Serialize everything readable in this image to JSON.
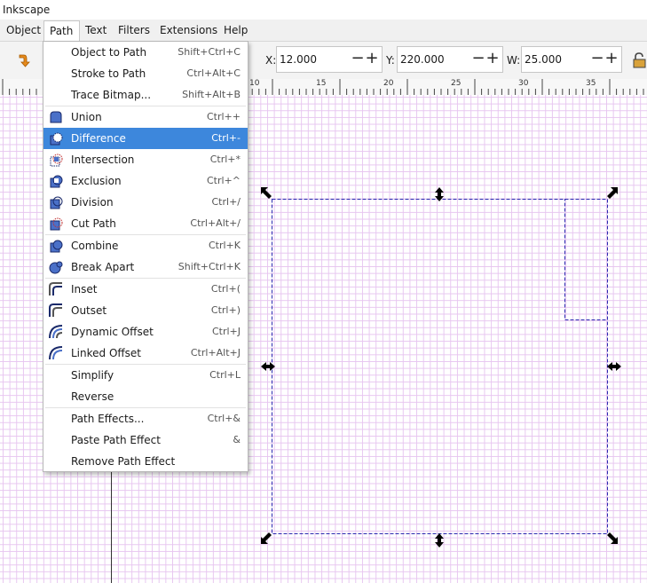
{
  "app": {
    "title": "Inkscape"
  },
  "menubar": [
    "Object",
    "Path",
    "Text",
    "Filters",
    "Extensions",
    "Help"
  ],
  "toolbar": {
    "x": {
      "label": "X:",
      "value": "12.000"
    },
    "y": {
      "label": "Y:",
      "value": "220.000"
    },
    "w": {
      "label": "W:",
      "value": "25.000"
    },
    "minus": "−",
    "plus": "+"
  },
  "ruler": {
    "ticks": [
      "10",
      "15",
      "20",
      "25",
      "30",
      "35"
    ]
  },
  "path_menu": {
    "highlighted": "Difference",
    "items": [
      {
        "label": "Object to Path",
        "shortcut": "Shift+Ctrl+C",
        "icon": "none"
      },
      {
        "label": "Stroke to Path",
        "shortcut": "Ctrl+Alt+C",
        "icon": "none"
      },
      {
        "label": "Trace Bitmap...",
        "shortcut": "Shift+Alt+B",
        "icon": "none"
      },
      {
        "label": "Union",
        "shortcut": "Ctrl++",
        "icon": "union-icon"
      },
      {
        "label": "Difference",
        "shortcut": "Ctrl+-",
        "icon": "difference-icon"
      },
      {
        "label": "Intersection",
        "shortcut": "Ctrl+*",
        "icon": "intersection-icon"
      },
      {
        "label": "Exclusion",
        "shortcut": "Ctrl+^",
        "icon": "exclusion-icon"
      },
      {
        "label": "Division",
        "shortcut": "Ctrl+/",
        "icon": "division-icon"
      },
      {
        "label": "Cut Path",
        "shortcut": "Ctrl+Alt+/",
        "icon": "cut-path-icon"
      },
      {
        "label": "Combine",
        "shortcut": "Ctrl+K",
        "icon": "combine-icon"
      },
      {
        "label": "Break Apart",
        "shortcut": "Shift+Ctrl+K",
        "icon": "break-apart-icon"
      },
      {
        "label": "Inset",
        "shortcut": "Ctrl+(",
        "icon": "inset-icon"
      },
      {
        "label": "Outset",
        "shortcut": "Ctrl+)",
        "icon": "outset-icon"
      },
      {
        "label": "Dynamic Offset",
        "shortcut": "Ctrl+J",
        "icon": "dynamic-offset-icon"
      },
      {
        "label": "Linked Offset",
        "shortcut": "Ctrl+Alt+J",
        "icon": "linked-offset-icon"
      },
      {
        "label": "Simplify",
        "shortcut": "Ctrl+L",
        "icon": "none"
      },
      {
        "label": "Reverse",
        "shortcut": "",
        "icon": "none"
      },
      {
        "label": "Path Effects...",
        "shortcut": "Ctrl+&",
        "icon": "none"
      },
      {
        "label": "Paste Path Effect",
        "shortcut": "&",
        "icon": "none"
      },
      {
        "label": "Remove Path Effect",
        "shortcut": "",
        "icon": "none"
      }
    ]
  },
  "colors": {
    "grid": "#e7c6f0",
    "highlight": "#3d87dc",
    "selection": "#2b2bb0",
    "icon_fill": "#4a70c8"
  }
}
